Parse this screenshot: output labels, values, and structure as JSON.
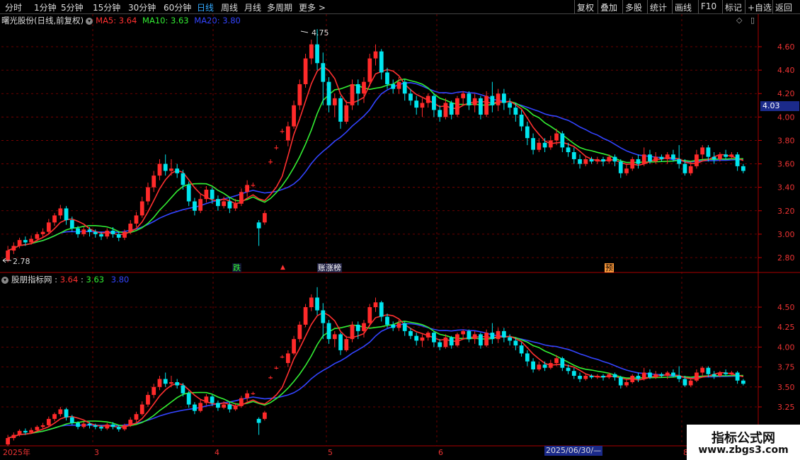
{
  "toolbar": {
    "periods": [
      "分时",
      "1分钟",
      "5分钟",
      "15分钟",
      "30分钟",
      "60分钟",
      "日线",
      "周线",
      "月线",
      "多周期",
      "更多"
    ],
    "active_period": "日线",
    "more_arrow": ">",
    "right": [
      "复权",
      "叠加",
      "多股",
      "统计",
      "画线",
      "F10",
      "标记",
      "+自选",
      "返回"
    ]
  },
  "main_panel": {
    "title": "曙光股份(日线,前复权)",
    "ma5": "MA5: 3.64",
    "ma10": "MA10: 3.63",
    "ma20": "MA20: 3.80",
    "y_ticks": [
      "4.60",
      "4.40",
      "4.20",
      "4.00",
      "3.80",
      "3.60",
      "3.40",
      "3.20",
      "3.00",
      "2.80"
    ],
    "current_price": "4.03",
    "high_label": "4.75",
    "low_label": "2.78"
  },
  "indicator_panel": {
    "title": "股朋指标网",
    "v1": "3.64",
    "v2": "3.63",
    "v3": "3.80",
    "y_ticks": [
      "4.50",
      "4.25",
      "4.00",
      "3.75",
      "3.50",
      "3.25"
    ]
  },
  "event_tags": [
    "跌",
    "账",
    "涨榜",
    "预"
  ],
  "x_labels": [
    "2025年",
    "3",
    "4",
    "5",
    "6",
    "8"
  ],
  "cursor_date": "2025/06/30/—",
  "watermark": {
    "line1": "指标公式网",
    "line2": "www.zbgs3.com"
  },
  "colors": {
    "ma5": "#ff3030",
    "ma10": "#33ee33",
    "ma20": "#3344ff",
    "up": "#ff2a2a",
    "down": "#00e5ee",
    "grid": "#8b0000"
  },
  "chart_data": {
    "type": "candlestick",
    "ylim": [
      2.72,
      4.78
    ],
    "candles": [
      [
        2.78,
        2.86,
        2.76,
        2.9
      ],
      [
        2.86,
        2.9,
        2.83,
        2.93
      ],
      [
        2.9,
        2.95,
        2.88,
        2.97
      ],
      [
        2.95,
        2.93,
        2.9,
        2.98
      ],
      [
        2.93,
        2.96,
        2.91,
        2.99
      ],
      [
        2.96,
        3.0,
        2.94,
        3.02
      ],
      [
        3.0,
        3.02,
        2.97,
        3.05
      ],
      [
        3.02,
        3.1,
        3.0,
        3.13
      ],
      [
        3.1,
        3.16,
        3.07,
        3.18
      ],
      [
        3.16,
        3.22,
        3.13,
        3.25
      ],
      [
        3.22,
        3.12,
        3.08,
        3.24
      ],
      [
        3.12,
        3.05,
        3.02,
        3.15
      ],
      [
        3.05,
        3.0,
        2.97,
        3.07
      ],
      [
        3.0,
        3.04,
        2.98,
        3.06
      ],
      [
        3.04,
        3.02,
        2.98,
        3.06
      ],
      [
        3.02,
        3.0,
        2.97,
        3.04
      ],
      [
        3.0,
        2.98,
        2.95,
        3.02
      ],
      [
        2.98,
        3.03,
        2.96,
        3.05
      ],
      [
        3.03,
        3.0,
        2.97,
        3.06
      ],
      [
        3.0,
        2.97,
        2.94,
        3.02
      ],
      [
        2.97,
        3.02,
        2.95,
        3.04
      ],
      [
        3.02,
        3.09,
        3.0,
        3.12
      ],
      [
        3.09,
        3.16,
        3.06,
        3.19
      ],
      [
        3.16,
        3.28,
        3.14,
        3.32
      ],
      [
        3.28,
        3.4,
        3.25,
        3.44
      ],
      [
        3.4,
        3.5,
        3.36,
        3.54
      ],
      [
        3.5,
        3.6,
        3.46,
        3.64
      ],
      [
        3.6,
        3.54,
        3.5,
        3.68
      ],
      [
        3.54,
        3.56,
        3.5,
        3.64
      ],
      [
        3.56,
        3.52,
        3.48,
        3.6
      ],
      [
        3.52,
        3.42,
        3.38,
        3.55
      ],
      [
        3.42,
        3.28,
        3.24,
        3.45
      ],
      [
        3.28,
        3.2,
        3.16,
        3.31
      ],
      [
        3.2,
        3.3,
        3.18,
        3.34
      ],
      [
        3.3,
        3.38,
        3.27,
        3.41
      ],
      [
        3.38,
        3.3,
        3.26,
        3.4
      ],
      [
        3.3,
        3.24,
        3.2,
        3.33
      ],
      [
        3.24,
        3.28,
        3.22,
        3.32
      ],
      [
        3.28,
        3.22,
        3.18,
        3.31
      ],
      [
        3.22,
        3.26,
        3.2,
        3.3
      ],
      [
        3.26,
        3.36,
        3.24,
        3.39
      ],
      [
        3.36,
        3.42,
        3.32,
        3.46
      ],
      [
        3.42,
        3.42,
        3.4,
        3.44
      ],
      [
        3.1,
        3.05,
        2.9,
        3.12
      ],
      [
        3.1,
        3.18,
        3.08,
        3.2
      ],
      [
        3.62,
        3.62,
        3.6,
        3.64
      ],
      [
        3.74,
        3.74,
        3.72,
        3.76
      ],
      [
        3.88,
        3.88,
        3.86,
        3.9
      ],
      [
        3.8,
        3.92,
        3.75,
        3.96
      ],
      [
        3.92,
        4.1,
        3.9,
        4.14
      ],
      [
        4.1,
        4.28,
        4.06,
        4.32
      ],
      [
        4.28,
        4.5,
        4.25,
        4.54
      ],
      [
        4.5,
        4.62,
        4.45,
        4.66
      ],
      [
        4.62,
        4.46,
        4.4,
        4.75
      ],
      [
        4.46,
        4.3,
        4.1,
        4.55
      ],
      [
        4.3,
        4.1,
        4.04,
        4.34
      ],
      [
        4.1,
        4.16,
        4.0,
        4.2
      ],
      [
        4.16,
        3.96,
        3.9,
        4.18
      ],
      [
        3.96,
        4.1,
        3.94,
        4.14
      ],
      [
        4.1,
        4.28,
        4.06,
        4.32
      ],
      [
        4.28,
        4.2,
        4.1,
        4.32
      ],
      [
        4.2,
        4.3,
        4.12,
        4.34
      ],
      [
        4.3,
        4.5,
        4.26,
        4.54
      ],
      [
        4.5,
        4.56,
        4.44,
        4.62
      ],
      [
        4.56,
        4.38,
        4.32,
        4.58
      ],
      [
        4.38,
        4.28,
        4.24,
        4.42
      ],
      [
        4.28,
        4.24,
        4.2,
        4.32
      ],
      [
        4.24,
        4.3,
        4.2,
        4.34
      ],
      [
        4.3,
        4.2,
        4.14,
        4.32
      ],
      [
        4.2,
        4.14,
        4.1,
        4.24
      ],
      [
        4.14,
        4.08,
        4.02,
        4.18
      ],
      [
        4.08,
        4.12,
        4.0,
        4.16
      ],
      [
        4.12,
        4.18,
        4.08,
        4.2
      ],
      [
        4.18,
        4.06,
        4.0,
        4.2
      ],
      [
        4.06,
        4.0,
        3.96,
        4.1
      ],
      [
        4.0,
        4.12,
        3.98,
        4.16
      ],
      [
        4.12,
        4.02,
        3.98,
        4.14
      ],
      [
        4.02,
        4.16,
        4.0,
        4.18
      ],
      [
        4.16,
        4.2,
        4.1,
        4.22
      ],
      [
        4.2,
        4.1,
        4.06,
        4.22
      ],
      [
        4.1,
        4.16,
        4.04,
        4.2
      ],
      [
        4.16,
        4.02,
        3.98,
        4.18
      ],
      [
        4.02,
        4.18,
        4.0,
        4.22
      ],
      [
        4.18,
        4.1,
        4.04,
        4.3
      ],
      [
        4.1,
        4.2,
        4.05,
        4.24
      ],
      [
        4.2,
        4.12,
        4.06,
        4.24
      ],
      [
        4.12,
        4.08,
        4.02,
        4.16
      ],
      [
        4.08,
        4.02,
        3.96,
        4.12
      ],
      [
        4.02,
        3.92,
        3.88,
        4.06
      ],
      [
        3.92,
        3.82,
        3.76,
        3.96
      ],
      [
        3.82,
        3.72,
        3.68,
        3.86
      ],
      [
        3.72,
        3.78,
        3.7,
        3.82
      ],
      [
        3.78,
        3.74,
        3.7,
        3.82
      ],
      [
        3.74,
        3.8,
        3.72,
        3.84
      ],
      [
        3.8,
        3.86,
        3.76,
        3.9
      ],
      [
        3.86,
        3.74,
        3.7,
        3.88
      ],
      [
        3.74,
        3.7,
        3.66,
        3.78
      ],
      [
        3.7,
        3.64,
        3.6,
        3.74
      ],
      [
        3.64,
        3.6,
        3.56,
        3.68
      ],
      [
        3.6,
        3.64,
        3.58,
        3.66
      ],
      [
        3.64,
        3.62,
        3.6,
        3.66
      ],
      [
        3.62,
        3.64,
        3.6,
        3.66
      ],
      [
        3.64,
        3.62,
        3.58,
        3.66
      ],
      [
        3.62,
        3.66,
        3.6,
        3.68
      ],
      [
        3.66,
        3.62,
        3.58,
        3.68
      ],
      [
        3.62,
        3.52,
        3.48,
        3.64
      ],
      [
        3.52,
        3.56,
        3.5,
        3.6
      ],
      [
        3.56,
        3.64,
        3.54,
        3.66
      ],
      [
        3.64,
        3.6,
        3.56,
        3.68
      ],
      [
        3.6,
        3.68,
        3.58,
        3.74
      ],
      [
        3.68,
        3.62,
        3.6,
        3.72
      ],
      [
        3.62,
        3.66,
        3.6,
        3.7
      ],
      [
        3.66,
        3.64,
        3.62,
        3.68
      ],
      [
        3.64,
        3.68,
        3.6,
        3.7
      ],
      [
        3.68,
        3.64,
        3.62,
        3.72
      ],
      [
        3.64,
        3.6,
        3.56,
        3.76
      ],
      [
        3.6,
        3.52,
        3.5,
        3.64
      ],
      [
        3.52,
        3.58,
        3.5,
        3.62
      ],
      [
        3.58,
        3.68,
        3.56,
        3.72
      ],
      [
        3.68,
        3.74,
        3.64,
        3.76
      ],
      [
        3.74,
        3.66,
        3.62,
        3.76
      ],
      [
        3.66,
        3.64,
        3.6,
        3.7
      ],
      [
        3.64,
        3.68,
        3.62,
        3.7
      ],
      [
        3.68,
        3.66,
        3.64,
        3.72
      ],
      [
        3.66,
        3.68,
        3.64,
        3.7
      ],
      [
        3.68,
        3.58,
        3.54,
        3.7
      ],
      [
        3.58,
        3.54,
        3.52,
        3.6
      ]
    ]
  }
}
